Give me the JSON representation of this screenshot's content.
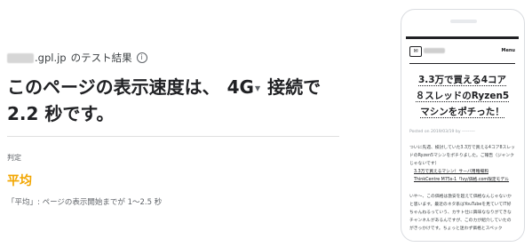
{
  "result": {
    "domain_suffix": ".gpl.jp",
    "title_suffix": "のテスト結果",
    "info_icon": "info-icon",
    "headline_before": "このページの表示速度は、",
    "network": "4G",
    "headline_after": "接続で 2.2 秒です。"
  },
  "verdict": {
    "label": "判定",
    "value": "平均",
    "description": "「平均」: ページの表示開始までが 1〜2.5 秒"
  },
  "preview": {
    "menu_label": "Menu",
    "post_title_lines": [
      "3.3万で買える4コア",
      "８スレッドのRyzen5",
      "マシンをポチった！"
    ],
    "post_meta": "Posted on 2019/03/19 by ---------",
    "paragraph1": "ついに先週、検討していた3.3万で買える4コア8スレッドのRyzen5マシンをポチりました。ご報告（ジャンクじゃないです）",
    "link_text": "3.3万で買えるマシン！サーバ用略場和 ThinkCentre M75s-1「Ivy/価格.com限定モデル",
    "paragraph2": "いや〜、この価格は激安を超えて価格なんじゃないかと思います。最近のネタ系はYouTubeを見ていてIT好ちゃんねるっていう、カサト仕に興味ななりがてきなチャンネルがあるんですが、このカが紹介していたのがきっかけです。ちょっと迷わず価格とスペック"
  },
  "colors": {
    "verdict": "#f2a600",
    "text": "#202124",
    "muted": "#5f6368"
  }
}
